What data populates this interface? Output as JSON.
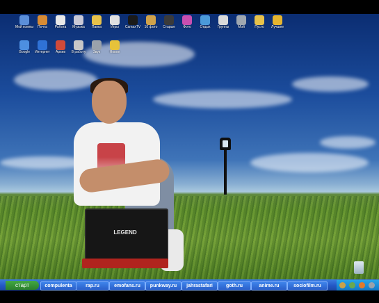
{
  "desktop": {
    "icons": [
      {
        "label": "Мой компьютер",
        "icon": "computer-icon",
        "color": "#5b8fd9"
      },
      {
        "label": "Почта",
        "icon": "mail-icon",
        "color": "#d88b34"
      },
      {
        "label": "Работа",
        "icon": "document-icon",
        "color": "#e8e8e8"
      },
      {
        "label": "Музыка",
        "icon": "music-icon",
        "color": "#c9c9d6"
      },
      {
        "label": "Папка",
        "icon": "folder-icon",
        "color": "#e8c24a"
      },
      {
        "label": "Игры",
        "icon": "game-icon",
        "color": "#e0e0e0"
      },
      {
        "label": "CamaxTV",
        "icon": "tv-icon",
        "color": "#1a1a1a"
      },
      {
        "label": "10 фото",
        "icon": "photo-icon",
        "color": "#d0a24a"
      },
      {
        "label": "Старые",
        "icon": "film-icon",
        "color": "#3a3a3a"
      },
      {
        "label": "Фото",
        "icon": "image-icon",
        "color": "#c94fb0"
      },
      {
        "label": "Отдых",
        "icon": "globe-icon",
        "color": "#4b9ad9"
      },
      {
        "label": "Группы",
        "icon": "cd-icon",
        "color": "#d9d9d9"
      },
      {
        "label": "Мой",
        "icon": "tools-icon",
        "color": "#9fa7b0"
      },
      {
        "label": "Пусто",
        "icon": "folder-icon",
        "color": "#e8c24a"
      },
      {
        "label": "Лучшее",
        "icon": "media-icon",
        "color": "#e6b52f"
      },
      {
        "label": "Google",
        "icon": "chrome-icon",
        "color": "#4d8fe0"
      },
      {
        "label": "Интернет",
        "icon": "browser-icon",
        "color": "#2f72d6"
      },
      {
        "label": "Архив",
        "icon": "archive-icon",
        "color": "#d04a3a"
      },
      {
        "label": "В работу",
        "icon": "phone-icon",
        "color": "#c7c7c7"
      },
      {
        "label": "Звук",
        "icon": "speaker-icon",
        "color": "#9aa2ab"
      },
      {
        "label": "Новое",
        "icon": "star-folder-icon",
        "color": "#e6c23a"
      }
    ],
    "laptop_brand": "LEGEND"
  },
  "taskbar": {
    "start_label": "старт",
    "tasks": [
      "compulenta",
      "rap.ru",
      "emofans.ru",
      "punkway.ru",
      "jahrastafari",
      "goth.ru",
      "anime.ru",
      "sociofilm.ru"
    ]
  },
  "colors": {
    "taskbar_blue": "#2458c6",
    "start_green": "#3a9a3a",
    "tray_blue": "#1d8ad8"
  }
}
